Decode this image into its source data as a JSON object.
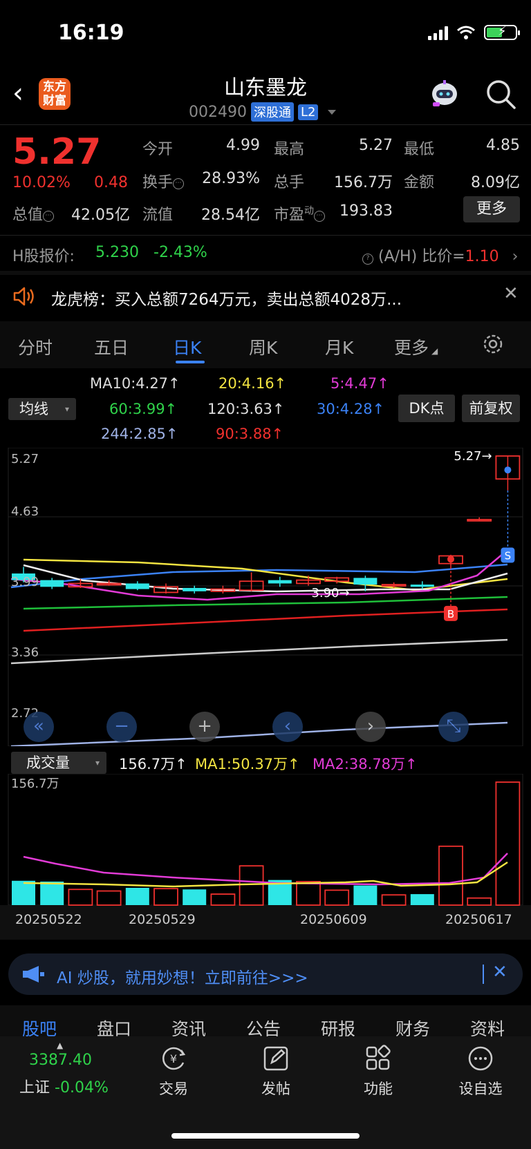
{
  "status": {
    "time": "16:19"
  },
  "header": {
    "logo_line1": "东方",
    "logo_line2": "财富",
    "title": "山东墨龙",
    "code": "002490",
    "tag1": "深股通",
    "tag2": "L2"
  },
  "quote": {
    "price": "5.27",
    "pct": "10.02%",
    "chg": "0.48",
    "labels": {
      "open": "今开",
      "high": "最高",
      "low": "最低",
      "turnover": "换手",
      "volume": "总手",
      "amount": "金额",
      "mktcap": "总值",
      "float": "流值",
      "pe": "市盈",
      "pe_sup": "动"
    },
    "values": {
      "open": "4.99",
      "high": "5.27",
      "low": "4.85",
      "turnover": "28.93%",
      "volume": "156.7万",
      "amount": "8.09亿",
      "mktcap": "42.05亿",
      "float": "28.54亿",
      "pe": "193.83"
    },
    "more": "更多"
  },
  "hshare": {
    "label": "H股报价:",
    "price": "5.230",
    "pct": "-2.43%",
    "ratio_label": "(A/H) 比价=",
    "ratio": "1.10"
  },
  "longhu": {
    "text": "龙虎榜：买入总额7264万元，卖出总额4028万..."
  },
  "tabs": [
    "分时",
    "五日",
    "日K",
    "周K",
    "月K",
    "更多"
  ],
  "ma": {
    "btn": "均线",
    "ma10": "MA10:4.27↑",
    "ma20": "20:4.16↑",
    "ma5": "5:4.47↑",
    "ma60": "60:3.99↑",
    "ma120": "120:3.63↑",
    "ma30": "30:4.28↑",
    "ma244": "244:2.85↑",
    "ma90": "90:3.88↑",
    "dk": "DK点",
    "fq": "前复权"
  },
  "chart_data": {
    "type": "candlestick",
    "y_ticks": [
      "5.27",
      "4.63",
      "3.99",
      "3.36",
      "2.72"
    ],
    "ylim": [
      2.72,
      5.27
    ],
    "annotations": {
      "max_label": "5.27→",
      "min_label": "3.90→",
      "buy": "B",
      "sell": "S"
    },
    "dates": [
      "20250522",
      "20250529",
      "20250609",
      "20250617"
    ],
    "candles": [
      {
        "o": 4.04,
        "c": 3.98,
        "h": 4.1,
        "l": 3.96
      },
      {
        "o": 3.98,
        "c": 3.92,
        "h": 4.0,
        "l": 3.9
      },
      {
        "o": 3.92,
        "c": 3.95,
        "h": 3.99,
        "l": 3.91
      },
      {
        "o": 3.95,
        "c": 3.95,
        "h": 3.98,
        "l": 3.93
      },
      {
        "o": 3.95,
        "c": 3.9,
        "h": 3.97,
        "l": 3.89
      },
      {
        "o": 3.87,
        "c": 3.92,
        "h": 3.95,
        "l": 3.86
      },
      {
        "o": 3.91,
        "c": 3.88,
        "h": 3.93,
        "l": 3.86
      },
      {
        "o": 3.88,
        "c": 3.9,
        "h": 3.93,
        "l": 3.86
      },
      {
        "o": 3.89,
        "c": 3.97,
        "h": 4.05,
        "l": 3.88
      },
      {
        "o": 3.98,
        "c": 3.95,
        "h": 4.01,
        "l": 3.92
      },
      {
        "o": 3.95,
        "c": 3.98,
        "h": 4.02,
        "l": 3.93
      },
      {
        "o": 3.97,
        "c": 4.0,
        "h": 4.01,
        "l": 3.95
      },
      {
        "o": 4.0,
        "c": 3.94,
        "h": 4.02,
        "l": 3.88
      },
      {
        "o": 3.93,
        "c": 3.94,
        "h": 3.96,
        "l": 3.91
      },
      {
        "o": 3.94,
        "c": 3.92,
        "h": 3.97,
        "l": 3.9
      },
      {
        "o": 4.13,
        "c": 4.2,
        "h": 4.21,
        "l": 4.1
      },
      {
        "o": 4.52,
        "c": 4.53,
        "h": 4.55,
        "l": 4.52
      },
      {
        "o": 4.99,
        "c": 5.27,
        "h": 5.27,
        "l": 4.85
      }
    ],
    "volume": {
      "btn": "成交量",
      "total": "156.7万↑",
      "ma1": "MA1:50.37万↑",
      "ma2": "MA2:38.78万↑",
      "axis_max": "156.7万",
      "ylim": [
        0,
        156.7
      ],
      "bars": [
        31,
        30,
        20,
        18,
        22,
        21,
        20,
        14,
        50,
        32,
        30,
        19,
        25,
        13,
        14,
        75,
        9,
        156.7
      ]
    }
  },
  "ai": {
    "text": "AI 炒股，就用妙想！立即前往>>>"
  },
  "bottom_tabs": [
    "股吧",
    "盘口",
    "资讯",
    "公告",
    "研报",
    "财务",
    "资料"
  ],
  "footer": {
    "index_value": "3387.40",
    "index_name": "上证",
    "index_pct": "-0.04%",
    "nav": [
      "交易",
      "发帖",
      "功能",
      "设自选"
    ]
  },
  "colors": {
    "up": "#f0312e",
    "down": "#2ee6e6",
    "accent": "#3b82f6"
  }
}
